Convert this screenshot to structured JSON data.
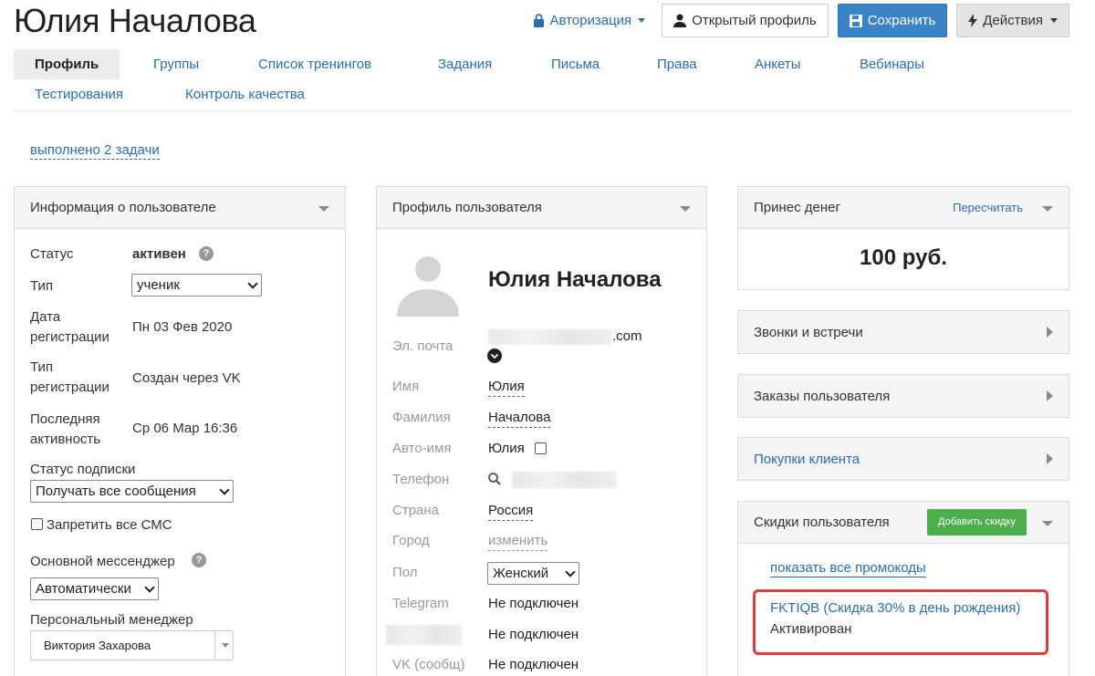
{
  "header": {
    "title": "Юлия Началова",
    "auth_label": "Авторизация",
    "open_profile_label": "Открытый профиль",
    "save_label": "Сохранить",
    "actions_label": "Действия"
  },
  "tabs": [
    {
      "label": "Профиль",
      "active": true
    },
    {
      "label": "Группы"
    },
    {
      "label": "Список тренингов"
    },
    {
      "label": "Задания"
    },
    {
      "label": "Письма"
    },
    {
      "label": "Права"
    },
    {
      "label": "Анкеты"
    },
    {
      "label": "Вебинары"
    },
    {
      "label": "Тестирования"
    },
    {
      "label": "Контроль качества"
    }
  ],
  "tasks_link": "выполнено 2 задачи",
  "user_info": {
    "title": "Информация о пользователе",
    "status_label": "Статус",
    "status_value": "активен",
    "type_label": "Тип",
    "type_value": "ученик",
    "reg_date_label": "Дата регистрации",
    "reg_date_value": "Пн 03 Фев 2020",
    "reg_type_label": "Тип регистрации",
    "reg_type_value": "Создан через VK",
    "last_activity_label": "Последняя активность",
    "last_activity_value": "Ср 06 Мар 16:36",
    "subscription_label": "Статус подписки",
    "subscription_value": "Получать все сообщения",
    "sms_label": "Запретить все СМС",
    "messenger_label": "Основной мессенджер",
    "messenger_value": "Автоматически",
    "manager_label": "Персональный менеджер",
    "manager_value": "Виктория Захарова"
  },
  "profile": {
    "title": "Профиль пользователя",
    "name": "Юлия Началова",
    "email_label": "Эл. почта",
    "email_suffix": ".com",
    "first_name_label": "Имя",
    "first_name_value": "Юлия",
    "last_name_label": "Фамилия",
    "last_name_value": "Началова",
    "auto_name_label": "Авто-имя",
    "auto_name_value": "Юлия",
    "phone_label": "Телефон",
    "country_label": "Страна",
    "country_value": "Россия",
    "city_label": "Город",
    "city_value": "изменить",
    "gender_label": "Пол",
    "gender_value": "Женский",
    "telegram_label": "Telegram",
    "telegram_value": "Не подключен",
    "hidden_value": "Не подключен",
    "vk_label": "VK (сообщ)",
    "vk_value": "Не подключен"
  },
  "money": {
    "title": "Принес денег",
    "recalc_label": "Пересчитать",
    "value": "100 руб."
  },
  "calls": {
    "title": "Звонки и встречи"
  },
  "orders": {
    "title": "Заказы пользователя"
  },
  "purchases": {
    "title": "Покупки клиента"
  },
  "discounts": {
    "title": "Скидки пользователя",
    "add_label": "Добавить скидку",
    "show_all_label": "показать все промокоды",
    "promo_label": "FKTIQB (Скидка 30% в день рождения)",
    "promo_status": "Активирован"
  },
  "colors": {
    "link": "#2a6db0",
    "primary": "#3a83c7",
    "green": "#4cae4c",
    "highlight": "#e23c3c"
  }
}
